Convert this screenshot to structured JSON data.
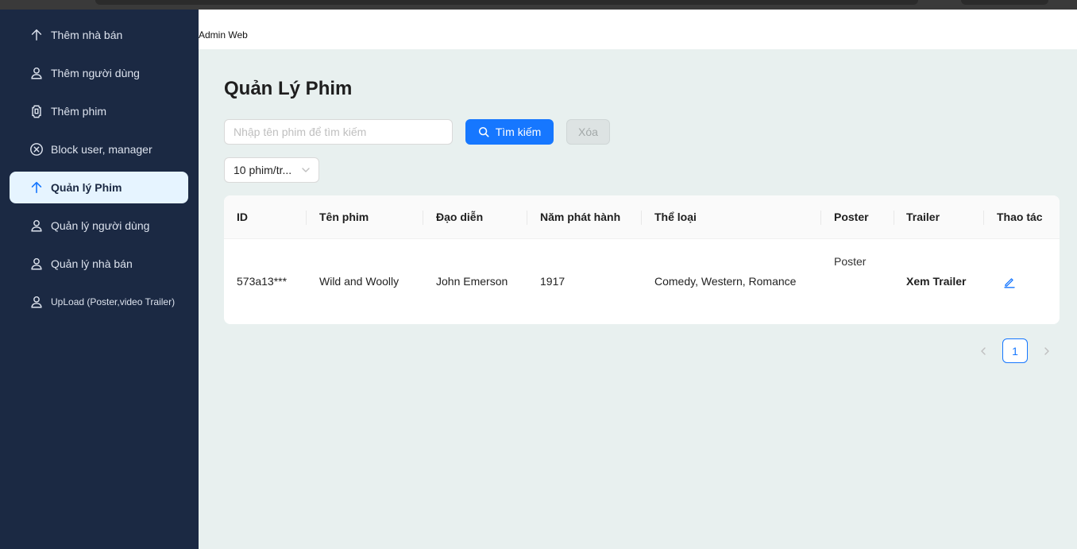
{
  "app": {
    "title": "Admin Web"
  },
  "sidebar": {
    "items": [
      {
        "label": "Thêm nhà bán",
        "icon": "arrow-up-icon"
      },
      {
        "label": "Thêm người dùng",
        "icon": "user-icon"
      },
      {
        "label": "Thêm phim",
        "icon": "film-icon"
      },
      {
        "label": "Block user, manager",
        "icon": "close-circle-icon"
      },
      {
        "label": "Quản lý Phim",
        "icon": "arrow-up-icon",
        "active": true
      },
      {
        "label": "Quản lý người dùng",
        "icon": "user-icon"
      },
      {
        "label": "Quản lý nhà bán",
        "icon": "user-icon"
      },
      {
        "label": "UpLoad (Poster,video Trailer)",
        "icon": "user-icon"
      }
    ]
  },
  "main": {
    "title": "Quản Lý Phim",
    "search": {
      "placeholder": "Nhập tên phim để tìm kiếm",
      "value": ""
    },
    "search_button": "Tìm kiếm",
    "clear_button": "Xóa",
    "page_size": "10 phim/tr...",
    "table": {
      "columns": [
        "ID",
        "Tên phim",
        "Đạo diễn",
        "Năm phát hành",
        "Thể loại",
        "Poster",
        "Trailer",
        "Thao tác"
      ],
      "rows": [
        {
          "id": "573a13***",
          "title": "Wild and Woolly",
          "director": "John Emerson",
          "year": "1917",
          "genres": "Comedy, Western, Romance",
          "poster_alt": "Poster",
          "trailer": "Xem Trailer"
        }
      ]
    },
    "pagination": {
      "current": "1"
    }
  },
  "colors": {
    "sidebar_bg": "#1b2943",
    "primary": "#1677ff",
    "page_bg": "#e8f0ef",
    "active_item_bg": "#e6f4ff"
  }
}
